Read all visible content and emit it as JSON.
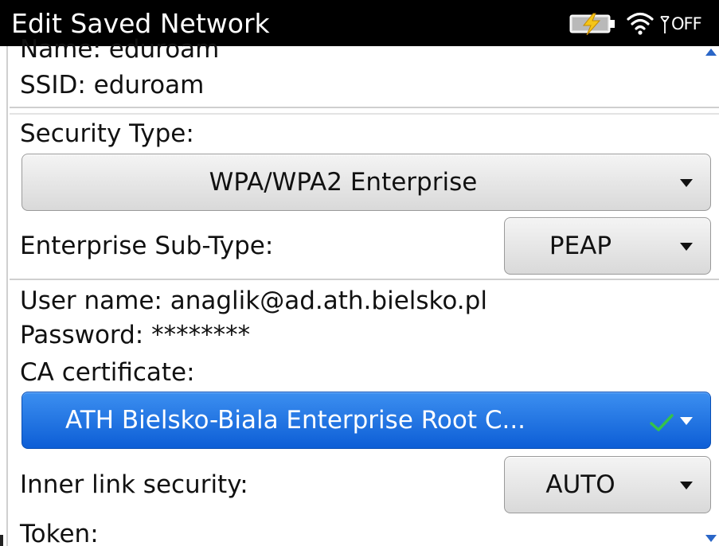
{
  "window": {
    "title": "Edit Saved Network",
    "radio_status": "OFF"
  },
  "network": {
    "name_line": "Name: eduroam",
    "ssid_line": "SSID: eduroam"
  },
  "security": {
    "label": "Security Type:",
    "value": "WPA/WPA2 Enterprise"
  },
  "subtype": {
    "label": "Enterprise Sub-Type:",
    "value": "PEAP"
  },
  "credentials": {
    "username_line": "User name: anaglik@ad.ath.bielsko.pl",
    "password_line": "Password: ********"
  },
  "ca_certificate": {
    "label": "CA certificate:",
    "value": "ATH Bielsko-Biala Enterprise Root C..."
  },
  "inner_link": {
    "label": "Inner link security:",
    "value": "AUTO"
  },
  "token": {
    "label": "Token:"
  },
  "colors": {
    "title_bar": "#000000",
    "selected_field": "#1466de",
    "check": "#35c24a",
    "battery_bolt": "#f5c518"
  },
  "icons": [
    "battery-charging-icon",
    "wifi-icon",
    "signal-icon",
    "scroll-up-icon",
    "scroll-down-icon",
    "chevron-down-icon",
    "checkmark-icon"
  ]
}
